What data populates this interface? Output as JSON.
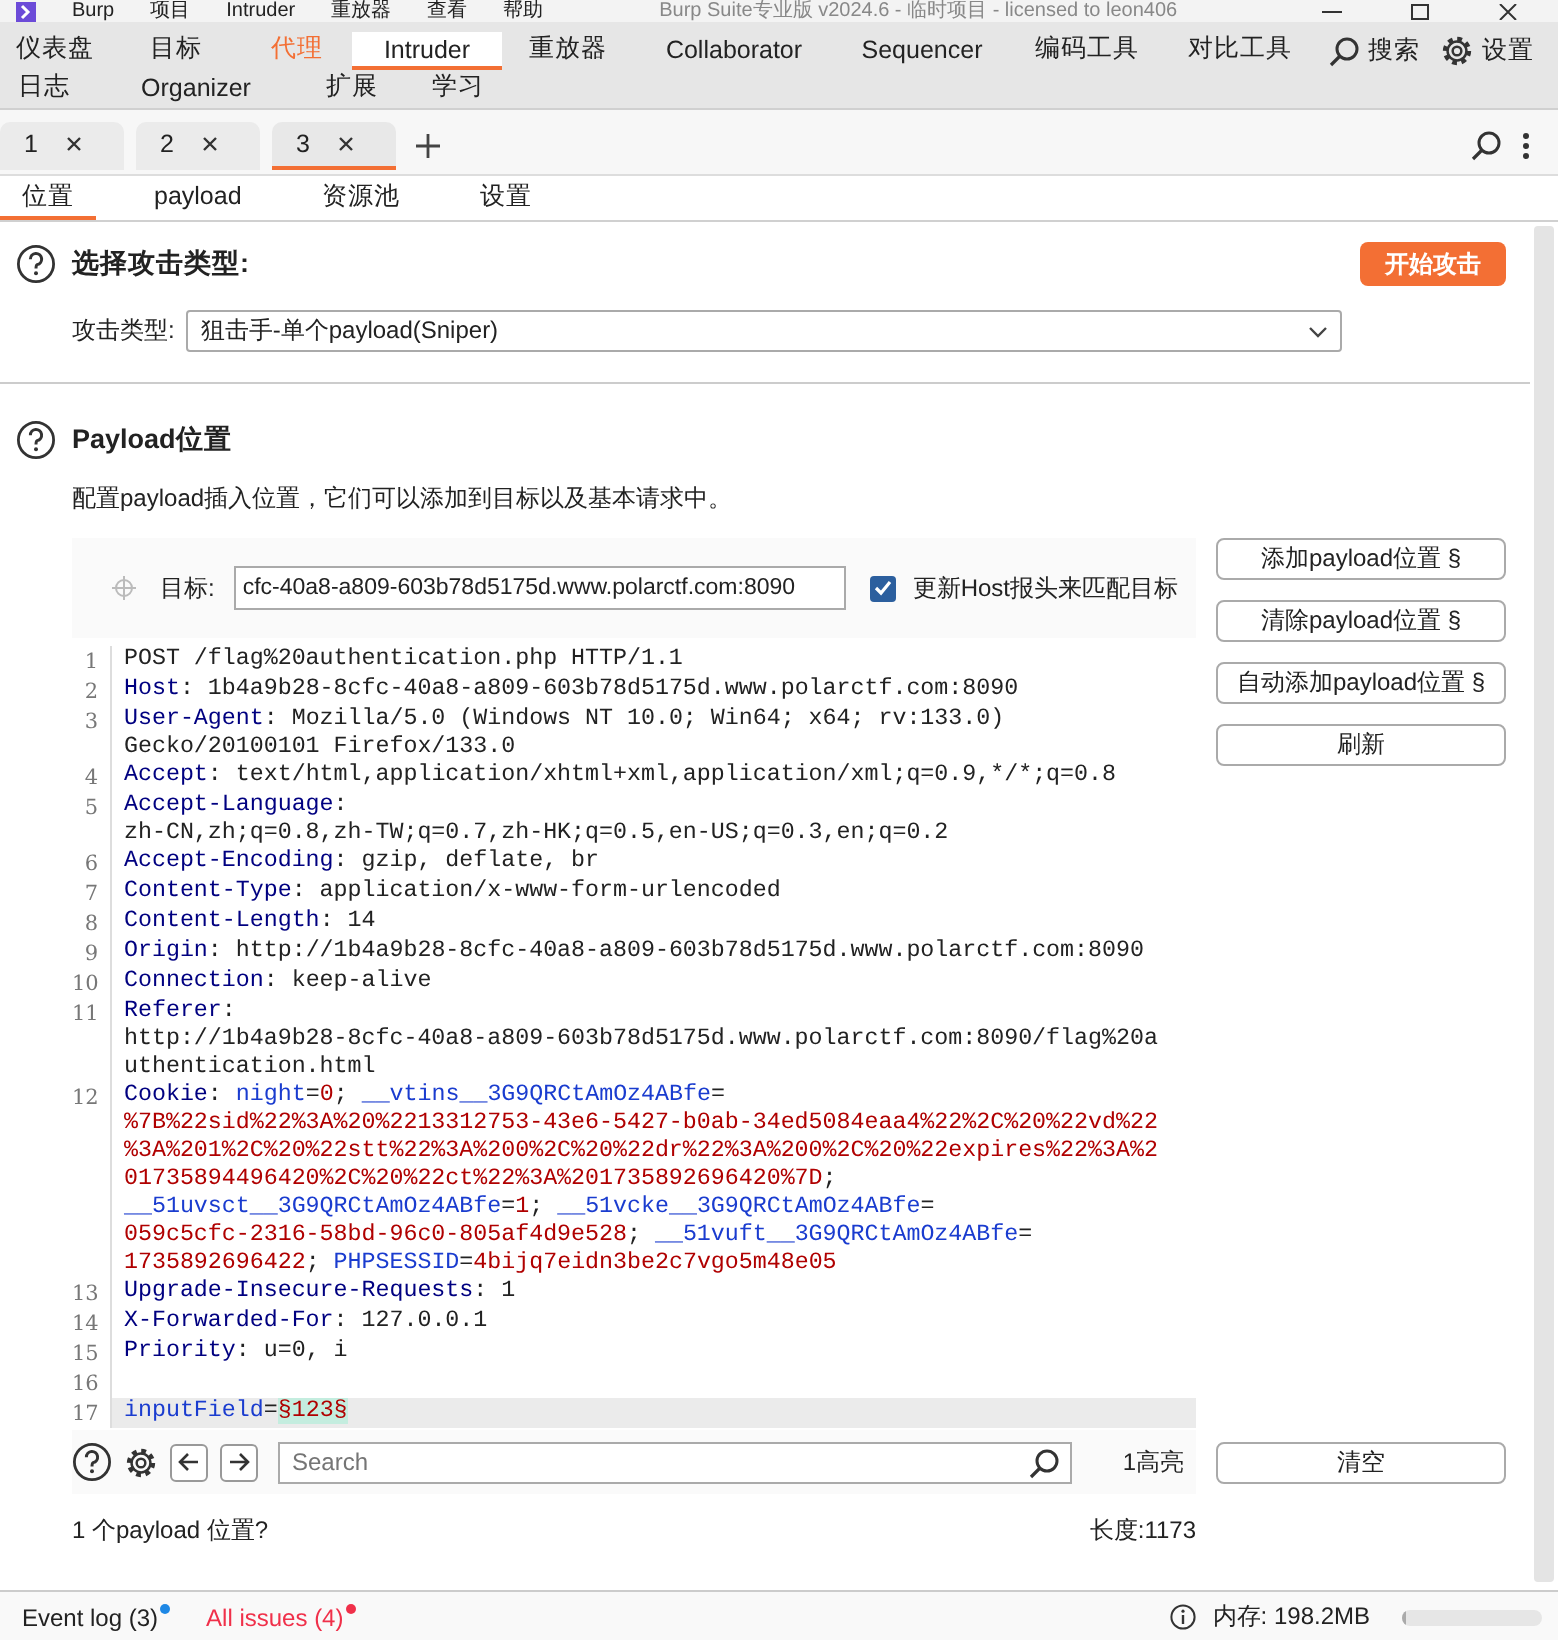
{
  "title_bar": {
    "menu": [
      "Burp",
      "项目",
      "Intruder",
      "重放器",
      "查看",
      "帮助"
    ],
    "title": "Burp Suite专业版  v2024.6 - 临时项目 - licensed to leon406"
  },
  "tool_tab_rows": [
    [
      {
        "label": "仪表盘",
        "selected": false,
        "alert": false
      },
      {
        "label": "目标",
        "selected": false,
        "alert": false
      },
      {
        "label": "代理",
        "selected": false,
        "alert": true
      },
      {
        "label": "Intruder",
        "selected": true,
        "alert": false
      },
      {
        "label": "重放器",
        "selected": false,
        "alert": false
      },
      {
        "label": "Collaborator",
        "selected": false,
        "alert": false
      },
      {
        "label": "Sequencer",
        "selected": false,
        "alert": false
      },
      {
        "label": "编码工具",
        "selected": false,
        "alert": false
      },
      {
        "label": "对比工具",
        "selected": false,
        "alert": false
      }
    ],
    [
      {
        "label": "日志",
        "selected": false,
        "alert": false
      },
      {
        "label": "Organizer",
        "selected": false,
        "alert": false
      },
      {
        "label": "扩展",
        "selected": false,
        "alert": false
      },
      {
        "label": "学习",
        "selected": false,
        "alert": false
      }
    ]
  ],
  "tool_actions": [
    {
      "kind": "search",
      "label": "搜索"
    },
    {
      "kind": "settings",
      "label": "设置"
    }
  ],
  "instance_tabs": [
    {
      "label": "1",
      "selected": false
    },
    {
      "label": "2",
      "selected": false
    },
    {
      "label": "3",
      "selected": true
    }
  ],
  "sub_tabs": [
    {
      "label": "位置",
      "selected": true
    },
    {
      "label": "payload",
      "selected": false
    },
    {
      "label": "资源池",
      "selected": false
    },
    {
      "label": "设置",
      "selected": false
    }
  ],
  "attack_type": {
    "heading": "选择攻击类型:",
    "start_button": "开始攻击",
    "label": "攻击类型:",
    "value": "狙击手-单个payload(Sniper)"
  },
  "positions": {
    "heading": "Payload位置",
    "description": "配置payload插入位置，它们可以添加到目标以及基本请求中。",
    "target_label": "目标:",
    "target_value": "cfc-40a8-a809-603b78d5175d.www.polarctf.com:8090",
    "update_host": {
      "label": "更新Host报头来匹配目标",
      "checked": true
    },
    "buttons": [
      "添加payload位置 §",
      "清除payload位置 §",
      "自动添加payload位置 §",
      "刷新"
    ],
    "clear_button": "清空",
    "search_placeholder": "Search",
    "highlight_count": "1高亮",
    "status": "1 个payload 位置?",
    "length": "长度:1173"
  },
  "request_lines": [
    {
      "number": "1",
      "current": false,
      "rows": [
        {
          "segments": [
            {
              "kind": "text",
              "text": "POST /flag%20authentication.php HTTP/1.1"
            }
          ]
        }
      ]
    },
    {
      "number": "2",
      "current": false,
      "rows": [
        {
          "segments": [
            {
              "kind": "name",
              "text": "Host"
            },
            {
              "kind": "text",
              "text": ": 1b4a9b28-8cfc-40a8-a809-603b78d5175d.www.polarctf.com:8090"
            }
          ]
        }
      ]
    },
    {
      "number": "3",
      "current": false,
      "rows": [
        {
          "segments": [
            {
              "kind": "name",
              "text": "User-Agent"
            },
            {
              "kind": "text",
              "text": ": Mozilla/5.0 (Windows NT 10.0; Win64; x64; rv:133.0)"
            }
          ]
        },
        {
          "segments": [
            {
              "kind": "text",
              "text": "Gecko/20100101 Firefox/133.0"
            }
          ]
        }
      ]
    },
    {
      "number": "4",
      "current": false,
      "rows": [
        {
          "segments": [
            {
              "kind": "name",
              "text": "Accept"
            },
            {
              "kind": "text",
              "text": ": text/html,application/xhtml+xml,application/xml;q=0.9,*/*;q=0.8"
            }
          ]
        }
      ]
    },
    {
      "number": "5",
      "current": false,
      "rows": [
        {
          "segments": [
            {
              "kind": "name",
              "text": "Accept-Language"
            },
            {
              "kind": "text",
              "text": ":"
            }
          ]
        },
        {
          "segments": [
            {
              "kind": "text",
              "text": "zh-CN,zh;q=0.8,zh-TW;q=0.7,zh-HK;q=0.5,en-US;q=0.3,en;q=0.2"
            }
          ]
        }
      ]
    },
    {
      "number": "6",
      "current": false,
      "rows": [
        {
          "segments": [
            {
              "kind": "name",
              "text": "Accept-Encoding"
            },
            {
              "kind": "text",
              "text": ": gzip, deflate, br"
            }
          ]
        }
      ]
    },
    {
      "number": "7",
      "current": false,
      "rows": [
        {
          "segments": [
            {
              "kind": "name",
              "text": "Content-Type"
            },
            {
              "kind": "text",
              "text": ": application/x-www-form-urlencoded"
            }
          ]
        }
      ]
    },
    {
      "number": "8",
      "current": false,
      "rows": [
        {
          "segments": [
            {
              "kind": "name",
              "text": "Content-Length"
            },
            {
              "kind": "text",
              "text": ": 14"
            }
          ]
        }
      ]
    },
    {
      "number": "9",
      "current": false,
      "rows": [
        {
          "segments": [
            {
              "kind": "name",
              "text": "Origin"
            },
            {
              "kind": "text",
              "text": ": http://1b4a9b28-8cfc-40a8-a809-603b78d5175d.www.polarctf.com:8090"
            }
          ]
        }
      ]
    },
    {
      "number": "10",
      "current": false,
      "rows": [
        {
          "segments": [
            {
              "kind": "name",
              "text": "Connection"
            },
            {
              "kind": "text",
              "text": ": keep-alive"
            }
          ]
        }
      ]
    },
    {
      "number": "11",
      "current": false,
      "rows": [
        {
          "segments": [
            {
              "kind": "name",
              "text": "Referer"
            },
            {
              "kind": "text",
              "text": ":"
            }
          ]
        },
        {
          "segments": [
            {
              "kind": "text",
              "text": "http://1b4a9b28-8cfc-40a8-a809-603b78d5175d.www.polarctf.com:8090/flag%20a"
            }
          ]
        },
        {
          "segments": [
            {
              "kind": "text",
              "text": "uthentication.html"
            }
          ]
        }
      ]
    },
    {
      "number": "12",
      "current": false,
      "rows": [
        {
          "segments": [
            {
              "kind": "name",
              "text": "Cookie"
            },
            {
              "kind": "text",
              "text": ": "
            },
            {
              "kind": "cname",
              "text": "night"
            },
            {
              "kind": "text",
              "text": "="
            },
            {
              "kind": "cvalue",
              "text": "0"
            },
            {
              "kind": "text",
              "text": "; "
            },
            {
              "kind": "cname",
              "text": "__vtins__3G9QRCtAmOz4ABfe"
            },
            {
              "kind": "text",
              "text": "="
            }
          ]
        },
        {
          "segments": [
            {
              "kind": "cvalue",
              "text": "%7B%22sid%22%3A%20%2213312753-43e6-5427-b0ab-34ed5084eaa4%22%2C%20%22vd%22"
            }
          ]
        },
        {
          "segments": [
            {
              "kind": "cvalue",
              "text": "%3A%201%2C%20%22stt%22%3A%200%2C%20%22dr%22%3A%200%2C%20%22expires%22%3A%2"
            }
          ]
        },
        {
          "segments": [
            {
              "kind": "cvalue",
              "text": "01735894496420%2C%20%22ct%22%3A%201735892696420%7D"
            },
            {
              "kind": "text",
              "text": ";"
            }
          ]
        },
        {
          "segments": [
            {
              "kind": "cname",
              "text": "__51uvsct__3G9QRCtAmOz4ABfe"
            },
            {
              "kind": "text",
              "text": "="
            },
            {
              "kind": "cvalue",
              "text": "1"
            },
            {
              "kind": "text",
              "text": "; "
            },
            {
              "kind": "cname",
              "text": "__51vcke__3G9QRCtAmOz4ABfe"
            },
            {
              "kind": "text",
              "text": "="
            }
          ]
        },
        {
          "segments": [
            {
              "kind": "cvalue",
              "text": "059c5cfc-2316-58bd-96c0-805af4d9e528"
            },
            {
              "kind": "text",
              "text": "; "
            },
            {
              "kind": "cname",
              "text": "__51vuft__3G9QRCtAmOz4ABfe"
            },
            {
              "kind": "text",
              "text": "="
            }
          ]
        },
        {
          "segments": [
            {
              "kind": "cvalue",
              "text": "1735892696422"
            },
            {
              "kind": "text",
              "text": "; "
            },
            {
              "kind": "cname",
              "text": "PHPSESSID"
            },
            {
              "kind": "text",
              "text": "="
            },
            {
              "kind": "cvalue",
              "text": "4bijq7eidn3be2c7vgo5m48e05"
            }
          ]
        }
      ]
    },
    {
      "number": "13",
      "current": false,
      "rows": [
        {
          "segments": [
            {
              "kind": "name",
              "text": "Upgrade-Insecure-Requests"
            },
            {
              "kind": "text",
              "text": ": 1"
            }
          ]
        }
      ]
    },
    {
      "number": "14",
      "current": false,
      "rows": [
        {
          "segments": [
            {
              "kind": "name",
              "text": "X-Forwarded-For"
            },
            {
              "kind": "text",
              "text": ": 127.0.0.1"
            }
          ]
        }
      ]
    },
    {
      "number": "15",
      "current": false,
      "rows": [
        {
          "segments": [
            {
              "kind": "name",
              "text": "Priority"
            },
            {
              "kind": "text",
              "text": ": u=0, i"
            }
          ]
        }
      ]
    },
    {
      "number": "16",
      "current": false,
      "rows": [
        {
          "segments": []
        }
      ]
    },
    {
      "number": "17",
      "current": true,
      "rows": [
        {
          "segments": [
            {
              "kind": "cname",
              "text": "inputField"
            },
            {
              "kind": "text",
              "text": "="
            },
            {
              "kind": "marker",
              "text": "§123§"
            }
          ]
        }
      ]
    }
  ],
  "status_bar": {
    "items": [
      {
        "label": "Event log (3)",
        "color": "#1e88e5",
        "emphasis": false
      },
      {
        "label": "All issues (4)",
        "color": "#f0304a",
        "emphasis": true
      }
    ],
    "memory": {
      "label": "内存: 198.2MB",
      "level": 0.03
    }
  }
}
